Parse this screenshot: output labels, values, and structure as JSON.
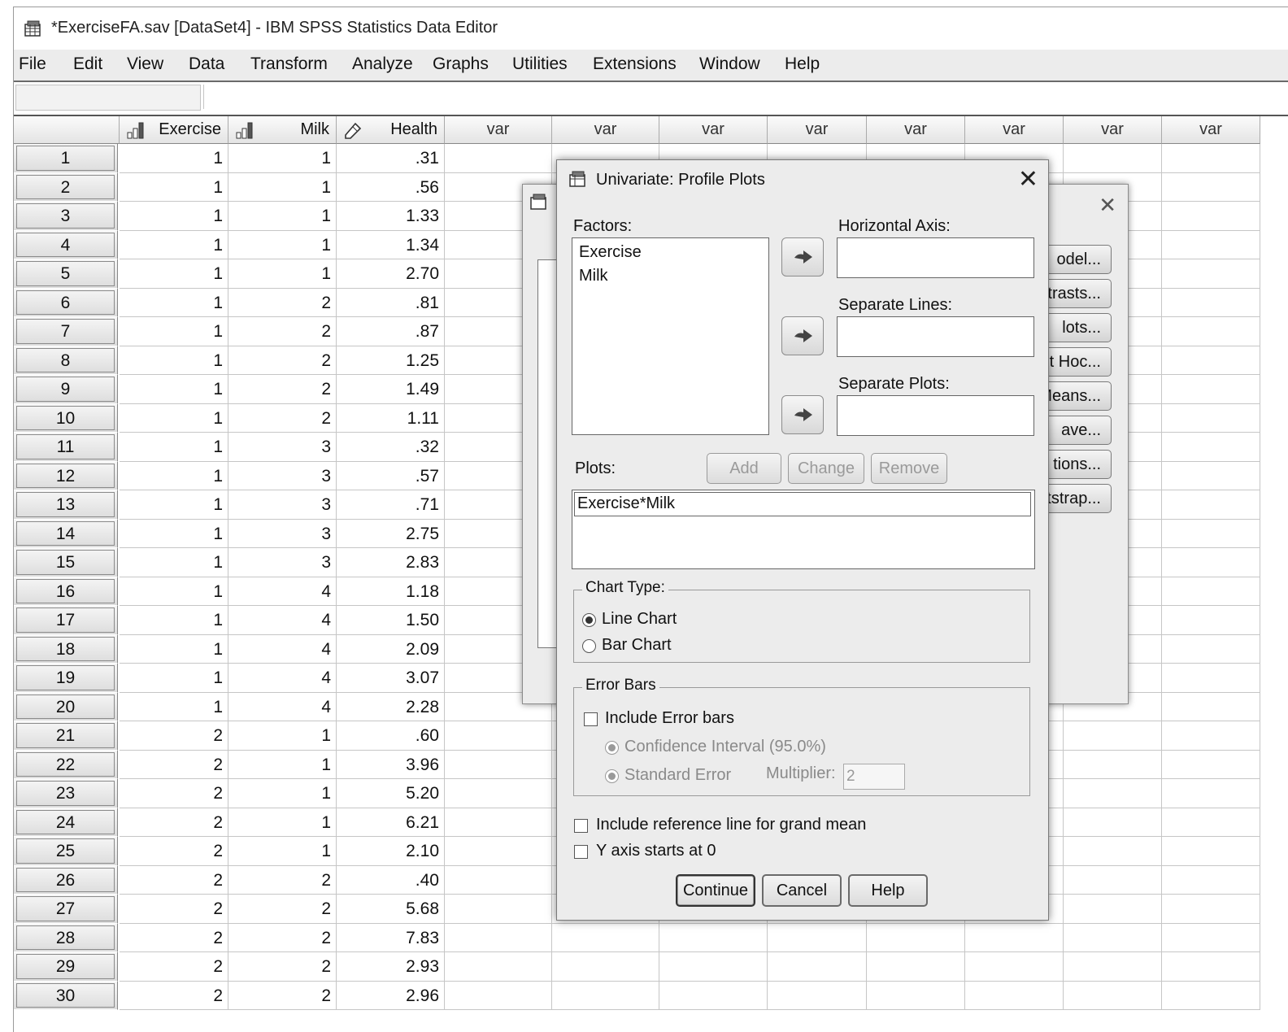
{
  "window": {
    "title": "*ExerciseFA.sav [DataSet4] - IBM SPSS Statistics Data Editor",
    "menu": [
      "File",
      "Edit",
      "View",
      "Data",
      "Transform",
      "Analyze",
      "Graphs",
      "Utilities",
      "Extensions",
      "Window",
      "Help"
    ]
  },
  "grid": {
    "columns": [
      "Exercise",
      "Milk",
      "Health",
      "var",
      "var",
      "var",
      "var",
      "var",
      "var",
      "var",
      "var"
    ],
    "rows": [
      [
        "1",
        "1",
        "1",
        ".31"
      ],
      [
        "2",
        "1",
        "1",
        ".56"
      ],
      [
        "3",
        "1",
        "1",
        "1.33"
      ],
      [
        "4",
        "1",
        "1",
        "1.34"
      ],
      [
        "5",
        "1",
        "1",
        "2.70"
      ],
      [
        "6",
        "1",
        "2",
        ".81"
      ],
      [
        "7",
        "1",
        "2",
        ".87"
      ],
      [
        "8",
        "1",
        "2",
        "1.25"
      ],
      [
        "9",
        "1",
        "2",
        "1.49"
      ],
      [
        "10",
        "1",
        "2",
        "1.11"
      ],
      [
        "11",
        "1",
        "3",
        ".32"
      ],
      [
        "12",
        "1",
        "3",
        ".57"
      ],
      [
        "13",
        "1",
        "3",
        ".71"
      ],
      [
        "14",
        "1",
        "3",
        "2.75"
      ],
      [
        "15",
        "1",
        "3",
        "2.83"
      ],
      [
        "16",
        "1",
        "4",
        "1.18"
      ],
      [
        "17",
        "1",
        "4",
        "1.50"
      ],
      [
        "18",
        "1",
        "4",
        "2.09"
      ],
      [
        "19",
        "1",
        "4",
        "3.07"
      ],
      [
        "20",
        "1",
        "4",
        "2.28"
      ],
      [
        "21",
        "2",
        "1",
        ".60"
      ],
      [
        "22",
        "2",
        "1",
        "3.96"
      ],
      [
        "23",
        "2",
        "1",
        "5.20"
      ],
      [
        "24",
        "2",
        "1",
        "6.21"
      ],
      [
        "25",
        "2",
        "1",
        "2.10"
      ],
      [
        "26",
        "2",
        "2",
        ".40"
      ],
      [
        "27",
        "2",
        "2",
        "5.68"
      ],
      [
        "28",
        "2",
        "2",
        "7.83"
      ],
      [
        "29",
        "2",
        "2",
        "2.93"
      ],
      [
        "30",
        "2",
        "2",
        "2.96"
      ]
    ]
  },
  "back_dialog": {
    "buttons": [
      "odel...",
      "trasts...",
      "lots...",
      "t Hoc...",
      "Means...",
      "ave...",
      "tions...",
      "tstrap..."
    ]
  },
  "dialog": {
    "title": "Univariate: Profile Plots",
    "factors_label": "Factors:",
    "factors": [
      "Exercise",
      "Milk"
    ],
    "horizontal_axis_label": "Horizontal Axis:",
    "separate_lines_label": "Separate Lines:",
    "separate_plots_label": "Separate Plots:",
    "plots_label": "Plots:",
    "add_label": "Add",
    "change_label": "Change",
    "remove_label": "Remove",
    "plots": [
      "Exercise*Milk"
    ],
    "chart_type_label": "Chart Type:",
    "line_chart_label": "Line Chart",
    "bar_chart_label": "Bar Chart",
    "error_bars_label": "Error Bars",
    "include_error_bars_label": "Include Error bars",
    "confidence_interval_label": "Confidence Interval (95.0%)",
    "standard_error_label": "Standard Error",
    "multiplier_label": "Multiplier:",
    "multiplier_value": "2",
    "grand_mean_label": "Include reference line for grand mean",
    "y_axis_zero_label": "Y axis starts at 0",
    "continue_label": "Continue",
    "cancel_label": "Cancel",
    "help_label": "Help"
  }
}
